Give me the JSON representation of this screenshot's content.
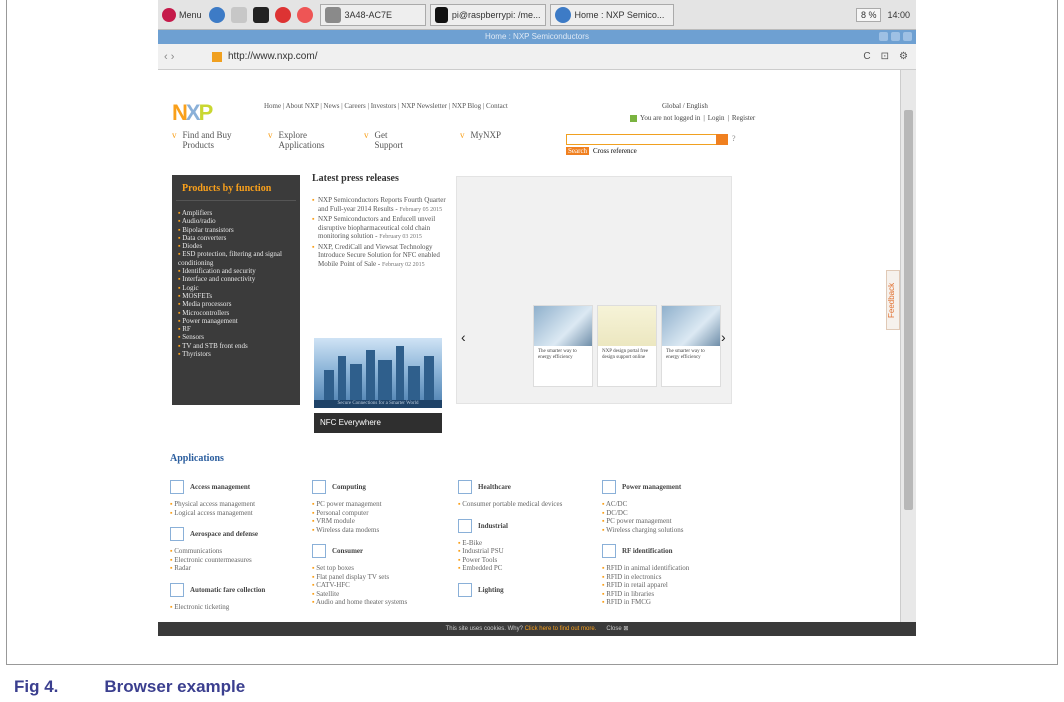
{
  "taskbar": {
    "menu": "Menu",
    "tasks": [
      "3A48-AC7E",
      "pi@raspberrypi: /me...",
      "Home : NXP Semico..."
    ],
    "cpu": "8 %",
    "clock": "14:00"
  },
  "window": {
    "title": "Home : NXP Semiconductors"
  },
  "browser": {
    "url": "http://www.nxp.com/",
    "back": "‹",
    "forward": "›",
    "reload": "C",
    "bookmark": "⊡",
    "settings": "⚙"
  },
  "header": {
    "logo": "NXP",
    "top_links": [
      "Home",
      "About NXP",
      "News",
      "Careers",
      "Investors",
      "NXP Newsletter",
      "NXP Blog",
      "Contact"
    ],
    "region": "Global / English",
    "login_text": "You are not logged in",
    "login": "Login",
    "register": "Register",
    "nav": [
      {
        "l1": "Find and Buy",
        "l2": "Products"
      },
      {
        "l1": "Explore",
        "l2": "Applications"
      },
      {
        "l1": "Get",
        "l2": "Support"
      },
      {
        "l1": "MyNXP",
        "l2": ""
      }
    ],
    "search_button": "Search",
    "cross_reference": "Cross reference",
    "help": "?"
  },
  "products": {
    "title": "Products by function",
    "items": [
      "Amplifiers",
      "Audio/radio",
      "Bipolar transistors",
      "Data converters",
      "Diodes",
      "ESD protection, filtering and signal conditioning",
      "Identification and security",
      "Interface and connectivity",
      "Logic",
      "MOSFETs",
      "Media processors",
      "Microcontrollers",
      "Power management",
      "RF",
      "Sensors",
      "TV and STB front ends",
      "Thyristors"
    ]
  },
  "press": {
    "title": "Latest press releases",
    "items": [
      {
        "text": "NXP Semiconductors Reports Fourth Quarter and Full-year 2014 Results",
        "date": "February 05 2015"
      },
      {
        "text": "NXP Semiconductors and Enfucell unveil disruptive biopharmaceutical cold chain monitoring solution",
        "date": "February 03 2015"
      },
      {
        "text": "NXP, CrediCall and Viewsat Technology Introduce Secure Solution for NFC enabled Mobile Point of Sale",
        "date": "February 02 2015"
      }
    ],
    "banner_caption": "Secure Connections for a Smarter World",
    "nfc": "NFC Everywhere"
  },
  "carousel": {
    "prev": "‹",
    "next": "›",
    "slides": [
      "The smarter way to energy efficiency",
      "NXP design portal free design support online",
      "The smarter way to energy efficiency"
    ]
  },
  "applications": {
    "title": "Applications",
    "columns": [
      [
        {
          "title": "Access management",
          "items": [
            "Physical access management",
            "Logical access management"
          ]
        },
        {
          "title": "Aerospace and defense",
          "items": [
            "Communications",
            "Electronic countermeasures",
            "Radar"
          ]
        },
        {
          "title": "Automatic fare collection",
          "items": [
            "Electronic ticketing"
          ]
        }
      ],
      [
        {
          "title": "Computing",
          "items": [
            "PC power management",
            "Personal computer",
            "VRM module",
            "Wireless data modems"
          ]
        },
        {
          "title": "Consumer",
          "items": [
            "Set top boxes",
            "Flat panel display TV sets",
            "CATV-HFC",
            "Satellite",
            "Audio and home theater systems"
          ]
        }
      ],
      [
        {
          "title": "Healthcare",
          "items": [
            "Consumer portable medical devices"
          ]
        },
        {
          "title": "Industrial",
          "items": [
            "E-Bike",
            "Industrial PSU",
            "Power Tools",
            "Embedded PC"
          ]
        },
        {
          "title": "Lighting",
          "items": []
        }
      ],
      [
        {
          "title": "Power management",
          "items": [
            "AC/DC",
            "DC/DC",
            "PC power management",
            "Wireless charging solutions"
          ]
        },
        {
          "title": "RF identification",
          "items": [
            "RFID in animal identification",
            "RFID in electronics",
            "RFID in retail apparel",
            "RFID in libraries",
            "RFID in FMCG"
          ]
        }
      ]
    ]
  },
  "cookie": {
    "text": "This site uses cookies. Why?",
    "link": "Click here to find out more.",
    "close": "Close ⊠"
  },
  "feedback": "Feedback",
  "caption": {
    "label": "Fig 4.",
    "title": "Browser example"
  },
  "colors": {
    "nxp_orange": "#f9a01b",
    "dark_panel": "#3b3b3b",
    "title_blue": "#6ea0d2",
    "caption": "#3b3f8f"
  }
}
